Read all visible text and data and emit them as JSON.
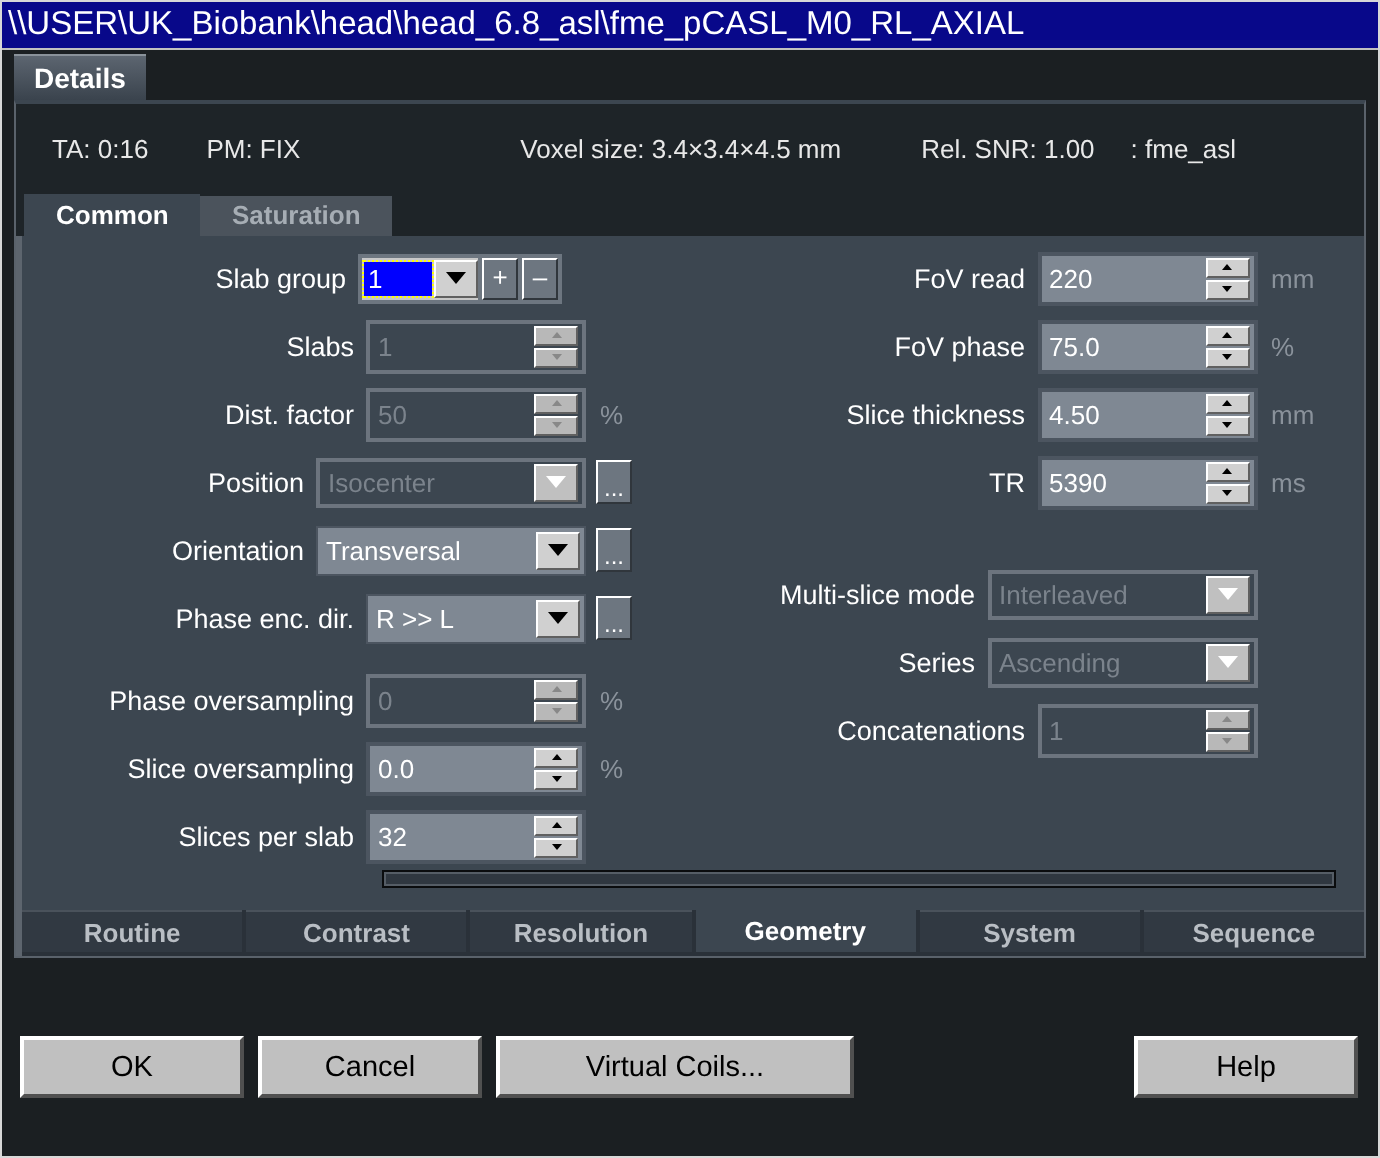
{
  "window": {
    "title": "\\\\USER\\UK_Biobank\\head\\head_6.8_asl\\fme_pCASL_M0_RL_AXIAL"
  },
  "top_tab": {
    "label": "Details"
  },
  "info": [
    "TA: 0:16",
    "PM: FIX",
    "Voxel size: 3.4×3.4×4.5 mm",
    "Rel. SNR: 1.00",
    ": fme_asl"
  ],
  "sub_tabs": [
    {
      "label": "Common",
      "selected": true
    },
    {
      "label": "Saturation",
      "selected": false
    }
  ],
  "left_fields": [
    {
      "kind": "combo",
      "label": "Slab group",
      "value": "1",
      "buttons": [
        {
          "label": "+"
        },
        {
          "label": "–"
        }
      ]
    },
    {
      "kind": "spinner",
      "label": "Slabs",
      "value": "1",
      "disabled": true
    },
    {
      "kind": "spinner",
      "label": "Dist. factor",
      "value": "50",
      "unit": "%",
      "disabled": true
    },
    {
      "kind": "dropdown",
      "label": "Position",
      "value": "Isocenter",
      "disabled": true,
      "more": "..."
    },
    {
      "kind": "dropdown",
      "label": "Orientation",
      "value": "Transversal",
      "disabled": false,
      "more": "..."
    },
    {
      "kind": "dropdown",
      "label": "Phase enc. dir.",
      "value": "R >> L",
      "disabled": false,
      "more": "..."
    },
    {
      "kind": "spinner",
      "label": "Phase oversampling",
      "value": "0",
      "unit": "%",
      "disabled": true
    },
    {
      "kind": "spinner",
      "label": "Slice oversampling",
      "value": "0.0",
      "unit": "%",
      "disabled": false
    },
    {
      "kind": "spinner",
      "label": "Slices per slab",
      "value": "32",
      "disabled": false
    }
  ],
  "right_fields": [
    {
      "kind": "spinner",
      "label": "FoV read",
      "value": "220",
      "unit": "mm",
      "disabled": false
    },
    {
      "kind": "spinner",
      "label": "FoV phase",
      "value": "75.0",
      "unit": "%",
      "disabled": false
    },
    {
      "kind": "spinner",
      "label": "Slice thickness",
      "value": "4.50",
      "unit": "mm",
      "disabled": false
    },
    {
      "kind": "spinner",
      "label": "TR",
      "value": "5390",
      "unit": "ms",
      "disabled": false
    },
    {
      "kind": "dropdown",
      "label": "Multi-slice mode",
      "value": "Interleaved",
      "disabled": true
    },
    {
      "kind": "dropdown",
      "label": "Series",
      "value": "Ascending",
      "disabled": true
    },
    {
      "kind": "spinner",
      "label": "Concatenations",
      "value": "1",
      "disabled": true
    }
  ],
  "progress": {
    "level": 0
  },
  "bottom_tabs": [
    {
      "label": "Routine",
      "selected": false
    },
    {
      "label": "Contrast",
      "selected": false
    },
    {
      "label": "Resolution",
      "selected": false
    },
    {
      "label": "Geometry",
      "selected": true
    },
    {
      "label": "System",
      "selected": false
    },
    {
      "label": "Sequence",
      "selected": false
    }
  ],
  "buttons": [
    {
      "label": "OK"
    },
    {
      "label": "Cancel"
    },
    {
      "label": "Virtual Coils..."
    },
    {
      "label": "Help"
    }
  ]
}
